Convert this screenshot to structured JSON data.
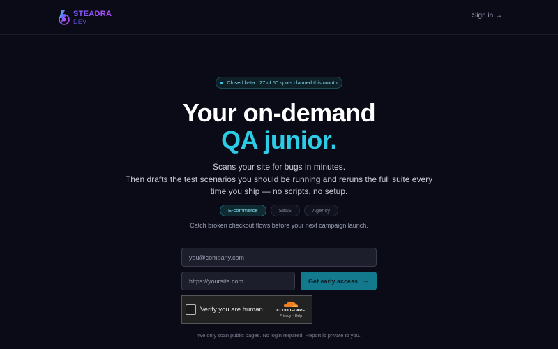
{
  "header": {
    "logo": {
      "name": "STEADRA",
      "sub": "DEV"
    },
    "sign_in": "Sign in →"
  },
  "badge": {
    "text": "Closed beta · 27 of 50 spots claimed this month"
  },
  "hero": {
    "title_line1": "Your on-demand",
    "title_line2": "QA junior.",
    "sub_line1": "Scans your site for bugs in minutes.",
    "sub_line2": "Then drafts the test scenarios you should be running and reruns the full suite every",
    "sub_line3": "time you ship — no scripts, no setup."
  },
  "pills": {
    "items": [
      {
        "label": "E-commerce",
        "active": true
      },
      {
        "label": "SaaS",
        "active": false
      },
      {
        "label": "Agency",
        "active": false
      }
    ],
    "caption": "Catch broken checkout flows before your next campaign launch."
  },
  "form": {
    "email_placeholder": "you@company.com",
    "site_placeholder": "https://yoursite.com",
    "cta_label": "Get early access",
    "cta_arrow": "→"
  },
  "captcha": {
    "label": "Verify you are human",
    "brand": "CLOUDFLARE",
    "privacy": "Privacy",
    "separator": "·",
    "help": "Help"
  },
  "footnote": "We only scan public pages. No login required. Report is private to you.",
  "colors": {
    "background": "#0b0b17",
    "accent": "#2ccbe6",
    "cta": "#13798d",
    "brand_gradient_start": "#7a5cff",
    "brand_gradient_end": "#b44cff"
  }
}
